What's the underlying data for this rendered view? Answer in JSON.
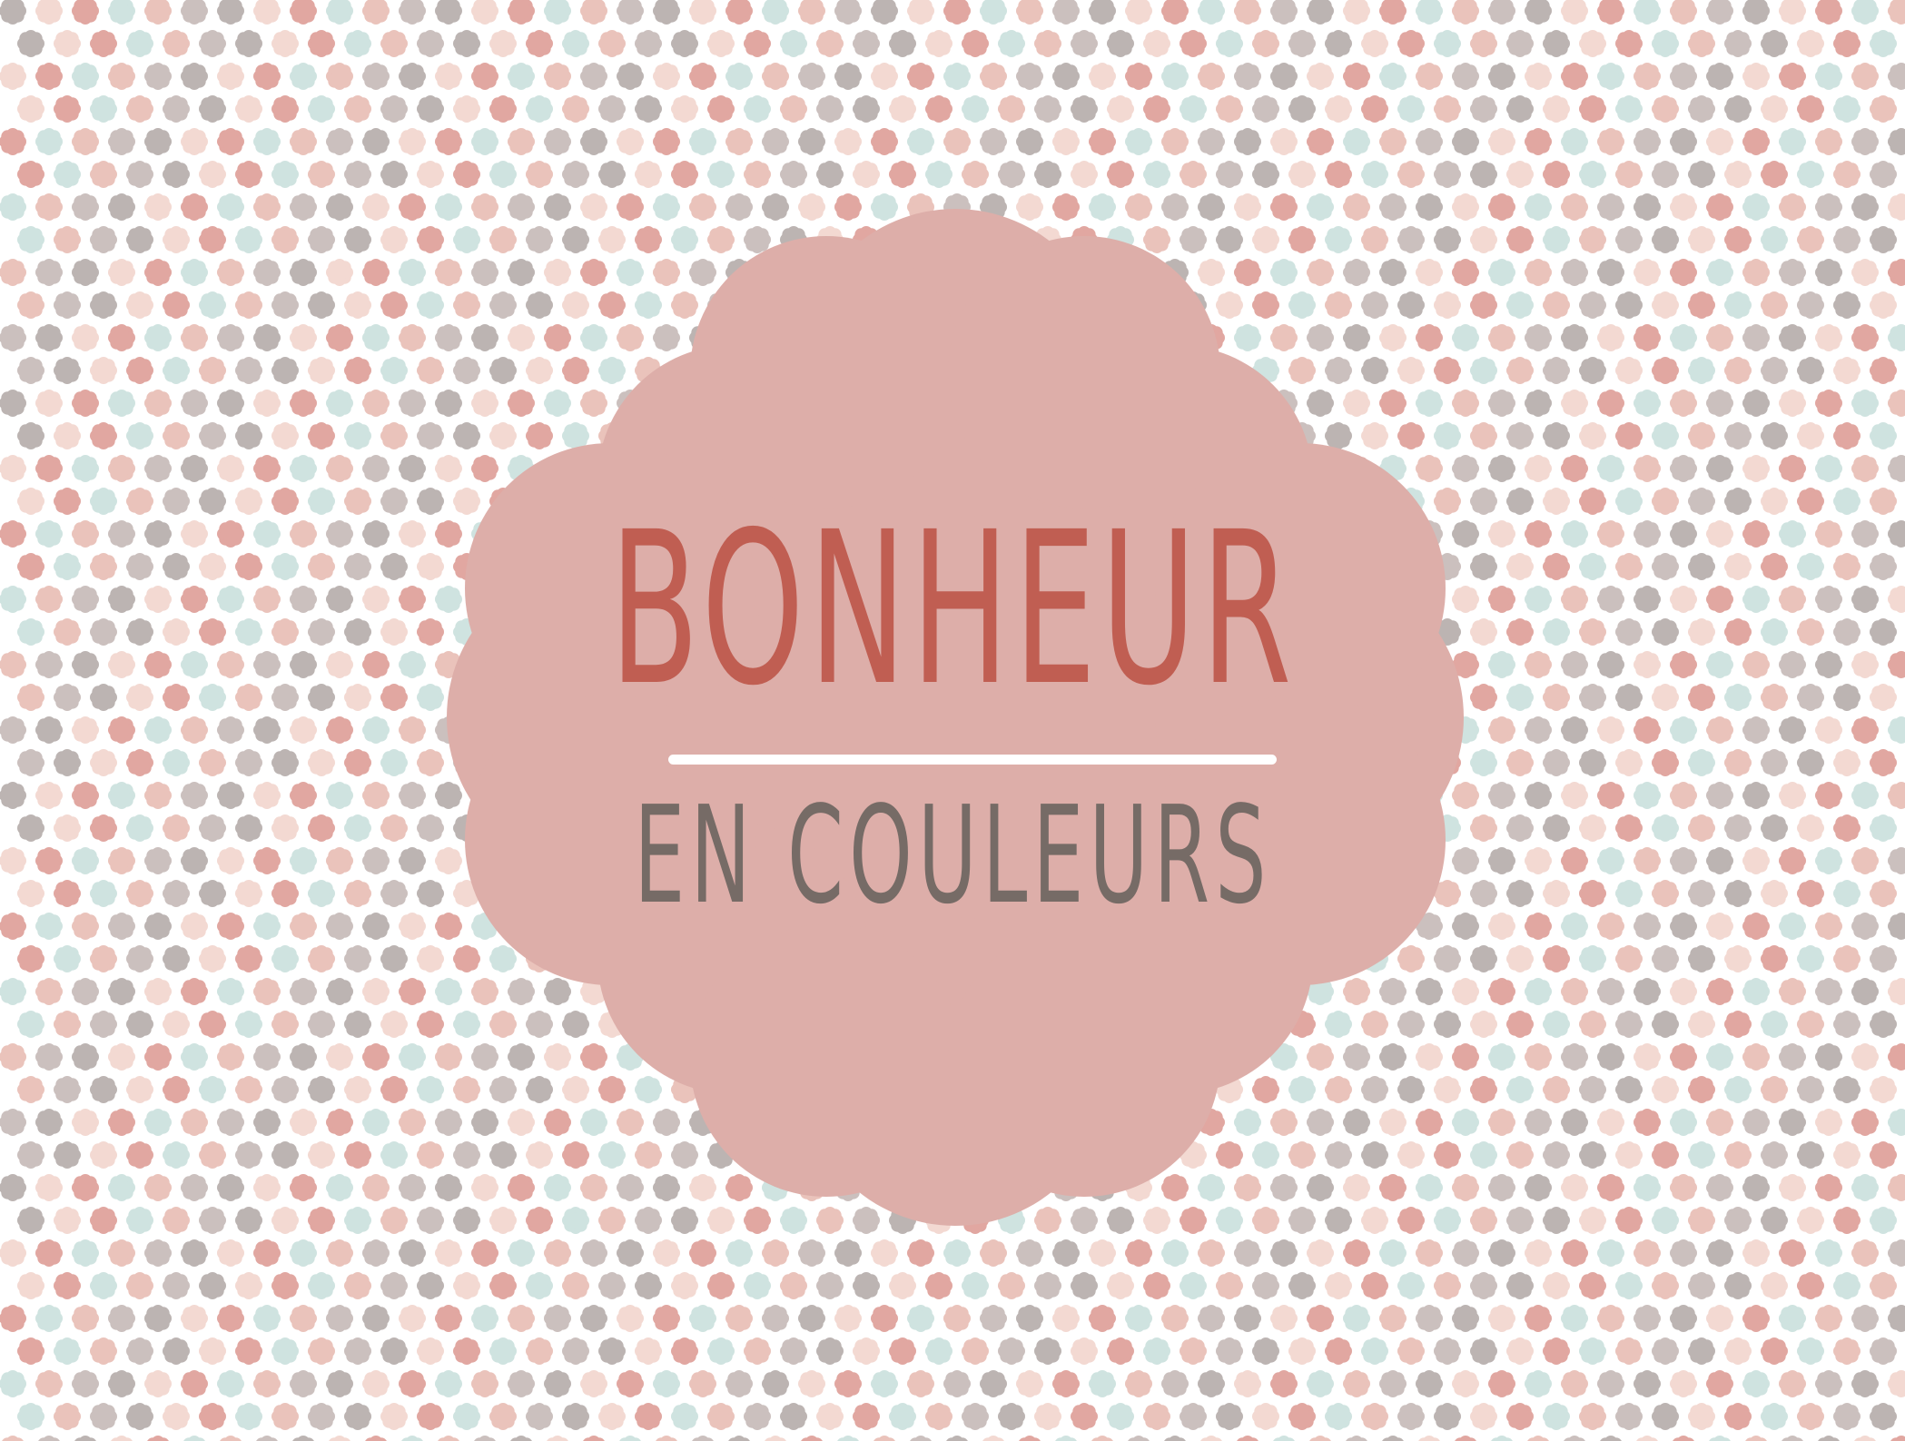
{
  "title": "BONHEUR",
  "subtitle": "EN COULEURS",
  "colors": {
    "background": "#ffffff",
    "badge": "#ddaea9",
    "title": "#c05e52",
    "subtitle": "#766b66",
    "divider": "#ffffff",
    "pattern": [
      "#bcb4b2",
      "#f3d9d2",
      "#e1a7a1",
      "#cfe3e0",
      "#eac3bb",
      "#cbc0be"
    ]
  },
  "icons": {
    "pattern": "scalloped-flower-icon",
    "badge": "scalloped-badge-icon"
  }
}
